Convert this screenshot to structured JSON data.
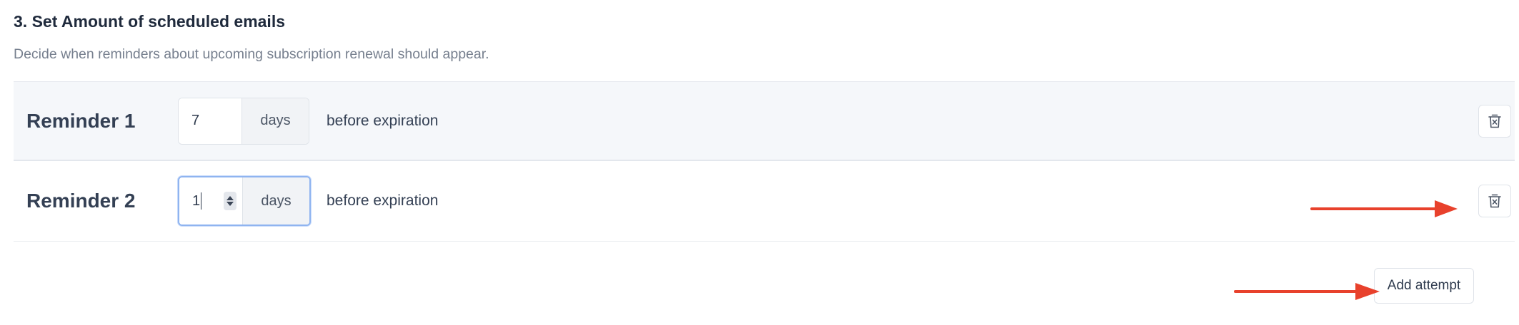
{
  "section": {
    "title": "3. Set Amount of scheduled emails",
    "description": "Decide when reminders about upcoming subscription renewal should appear."
  },
  "reminders": [
    {
      "label": "Reminder 1",
      "value": "7",
      "unit": "days",
      "suffix": "before expiration",
      "focused": false
    },
    {
      "label": "Reminder 2",
      "value": "1",
      "unit": "days",
      "suffix": "before expiration",
      "focused": true
    }
  ],
  "actions": {
    "add_label": "Add attempt"
  },
  "annotations": {
    "arrow_color": "#e8412c"
  },
  "icons": {
    "delete": "trash-x-icon",
    "stepper": "spin-stepper-icon"
  }
}
